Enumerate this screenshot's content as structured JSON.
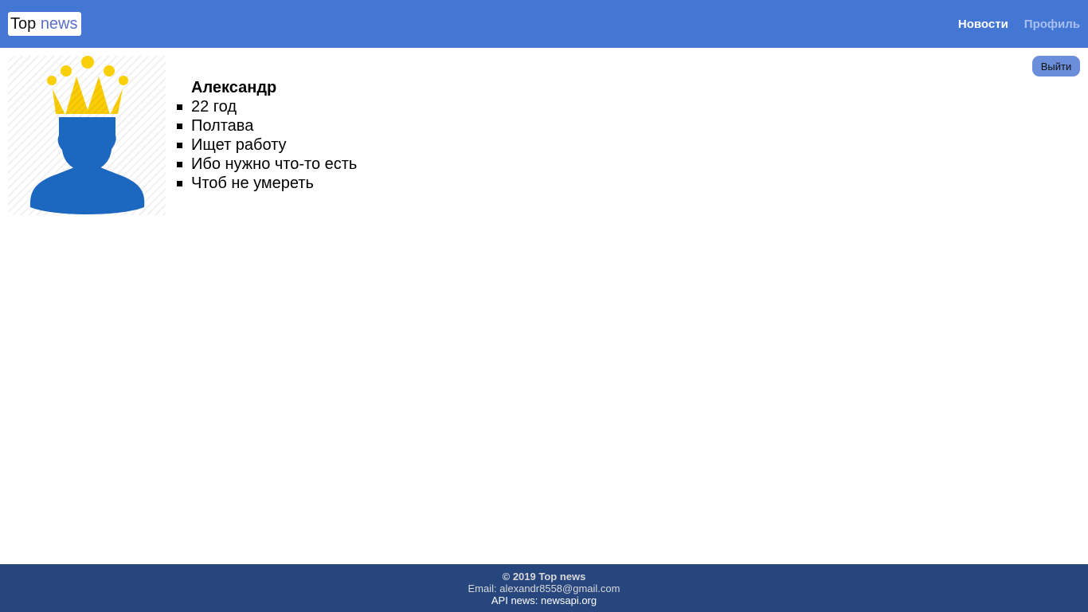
{
  "header": {
    "logo_top": "Top",
    "logo_news": "news",
    "nav": {
      "news_label": "Новости",
      "profile_label": "Профиль"
    }
  },
  "profile": {
    "avatar_icon": "user-crown-icon",
    "name": "Александр",
    "details": [
      "22 год",
      "Полтава",
      "Ищет работу",
      "Ибо нужно что-то есть",
      "Чтоб не умереть"
    ],
    "logout_label": "Выйти"
  },
  "footer": {
    "copyright": "© 2019 Top news",
    "email": "Email: alexandr8558@gmail.com",
    "api": "API news: newsapi.org"
  },
  "colors": {
    "header_bg": "#4477d4",
    "footer_bg": "#27467e",
    "avatar_blue": "#1c67c0",
    "crown_yellow": "#f9cf08"
  }
}
